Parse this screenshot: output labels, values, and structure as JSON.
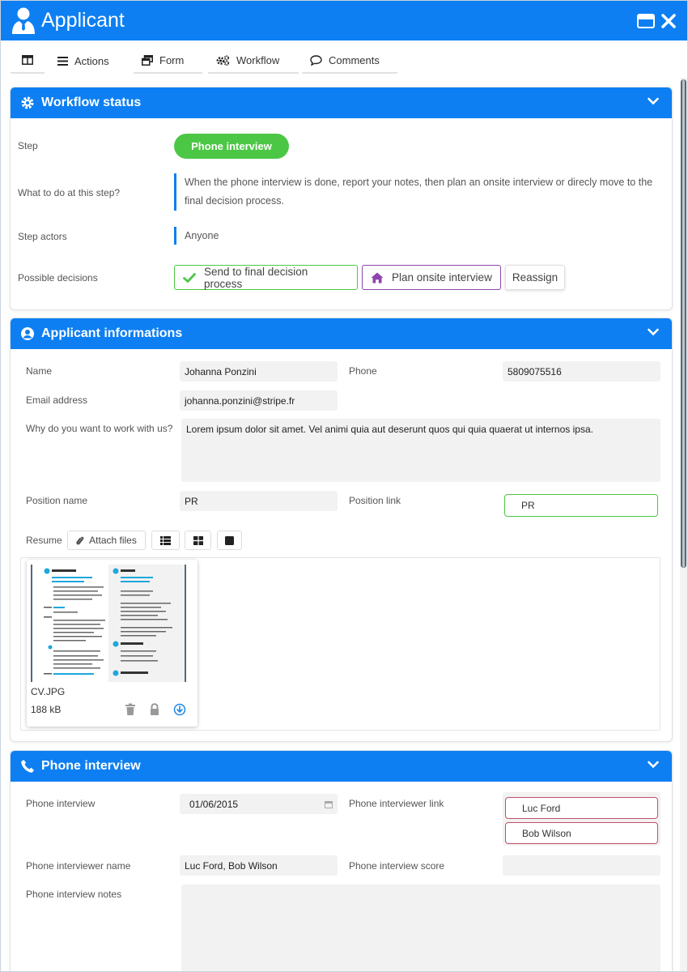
{
  "window": {
    "title": "Applicant"
  },
  "toolbar": {
    "actions": "Actions",
    "form": "Form",
    "workflow": "Workflow",
    "comments": "Comments"
  },
  "workflow_panel": {
    "title": "Workflow status",
    "step_label": "Step",
    "step_value": "Phone interview",
    "todo_label": "What to do at this step?",
    "todo_value": "When the phone interview is done, report your notes, then plan an onsite interview or direcly move to the final decision process.",
    "actors_label": "Step actors",
    "actors_value": "Anyone",
    "decisions_label": "Possible decisions",
    "decisions": [
      "Send to final decision process",
      "Plan onsite interview",
      "Reassign"
    ]
  },
  "applicant_panel": {
    "title": "Applicant informations",
    "name_label": "Name",
    "name_value": "Johanna Ponzini",
    "phone_label": "Phone",
    "phone_value": "5809075516",
    "email_label": "Email address",
    "email_value": "johanna.ponzini@stripe.fr",
    "why_label": "Why do you want to work with us?",
    "why_value": "Lorem ipsum dolor sit amet. Vel animi quia aut deserunt quos qui quia quaerat ut internos ipsa.",
    "position_name_label": "Position name",
    "position_name_value": "PR",
    "position_link_label": "Position link",
    "position_link_value": "PR",
    "resume_label": "Resume",
    "attach_label": "Attach files",
    "file": {
      "name": "CV.JPG",
      "size": "188 kB"
    }
  },
  "phone_panel": {
    "title": "Phone interview",
    "interview_label": "Phone interview",
    "interview_value": "01/06/2015",
    "interviewer_link_label": "Phone interviewer link",
    "interviewer_links": [
      "Luc Ford",
      "Bob Wilson"
    ],
    "interviewer_name_label": "Phone interviewer name",
    "interviewer_name_value": "Luc Ford, Bob Wilson",
    "score_label": "Phone interview score",
    "score_value": "",
    "notes_label": "Phone interview notes",
    "notes_value": ""
  },
  "colors": {
    "primary": "#0d7ff2",
    "success": "#4cc745",
    "purple": "#8e44ad",
    "link_person": "#c0506a"
  }
}
